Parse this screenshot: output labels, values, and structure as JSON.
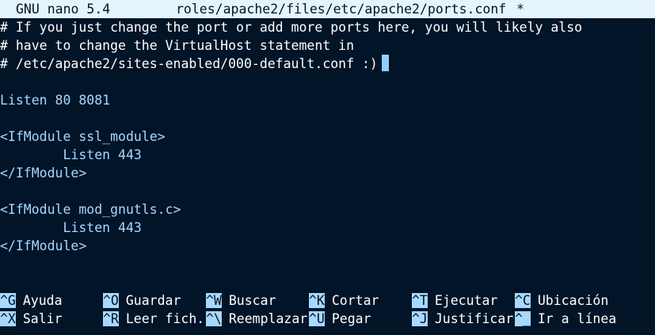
{
  "title_bar": {
    "app": "GNU nano 5.4",
    "file": "roles/apache2/files/etc/apache2/ports.conf",
    "modified": "*"
  },
  "editor": {
    "lines": [
      "# If you just change the port or add more ports here, you will likely also",
      "# have to change the VirtualHost statement in",
      "# /etc/apache2/sites-enabled/000-default.conf :)",
      "",
      "Listen 80 8081",
      "",
      "<IfModule ssl_module>",
      "        Listen 443",
      "</IfModule>",
      "",
      "<IfModule mod_gnutls.c>",
      "        Listen 443",
      "</IfModule>"
    ]
  },
  "shortcuts": {
    "row1": [
      {
        "key": "^G",
        "label": "Ayuda"
      },
      {
        "key": "^O",
        "label": "Guardar"
      },
      {
        "key": "^W",
        "label": "Buscar"
      },
      {
        "key": "^K",
        "label": "Cortar"
      },
      {
        "key": "^T",
        "label": "Ejecutar"
      },
      {
        "key": "^C",
        "label": "Ubicación"
      }
    ],
    "row2": [
      {
        "key": "^X",
        "label": "Salir"
      },
      {
        "key": "^R",
        "label": "Leer fich."
      },
      {
        "key": "^\\",
        "label": "Reemplazar"
      },
      {
        "key": "^U",
        "label": "Pegar"
      },
      {
        "key": "^J",
        "label": "Justificar"
      },
      {
        "key": "^_",
        "label": "Ir a línea"
      }
    ]
  },
  "colors": {
    "background": "#011428",
    "title_bar": "#e6f4fc",
    "keyword_text": "#a7d8ff",
    "cursor": "#8fd0ff"
  }
}
